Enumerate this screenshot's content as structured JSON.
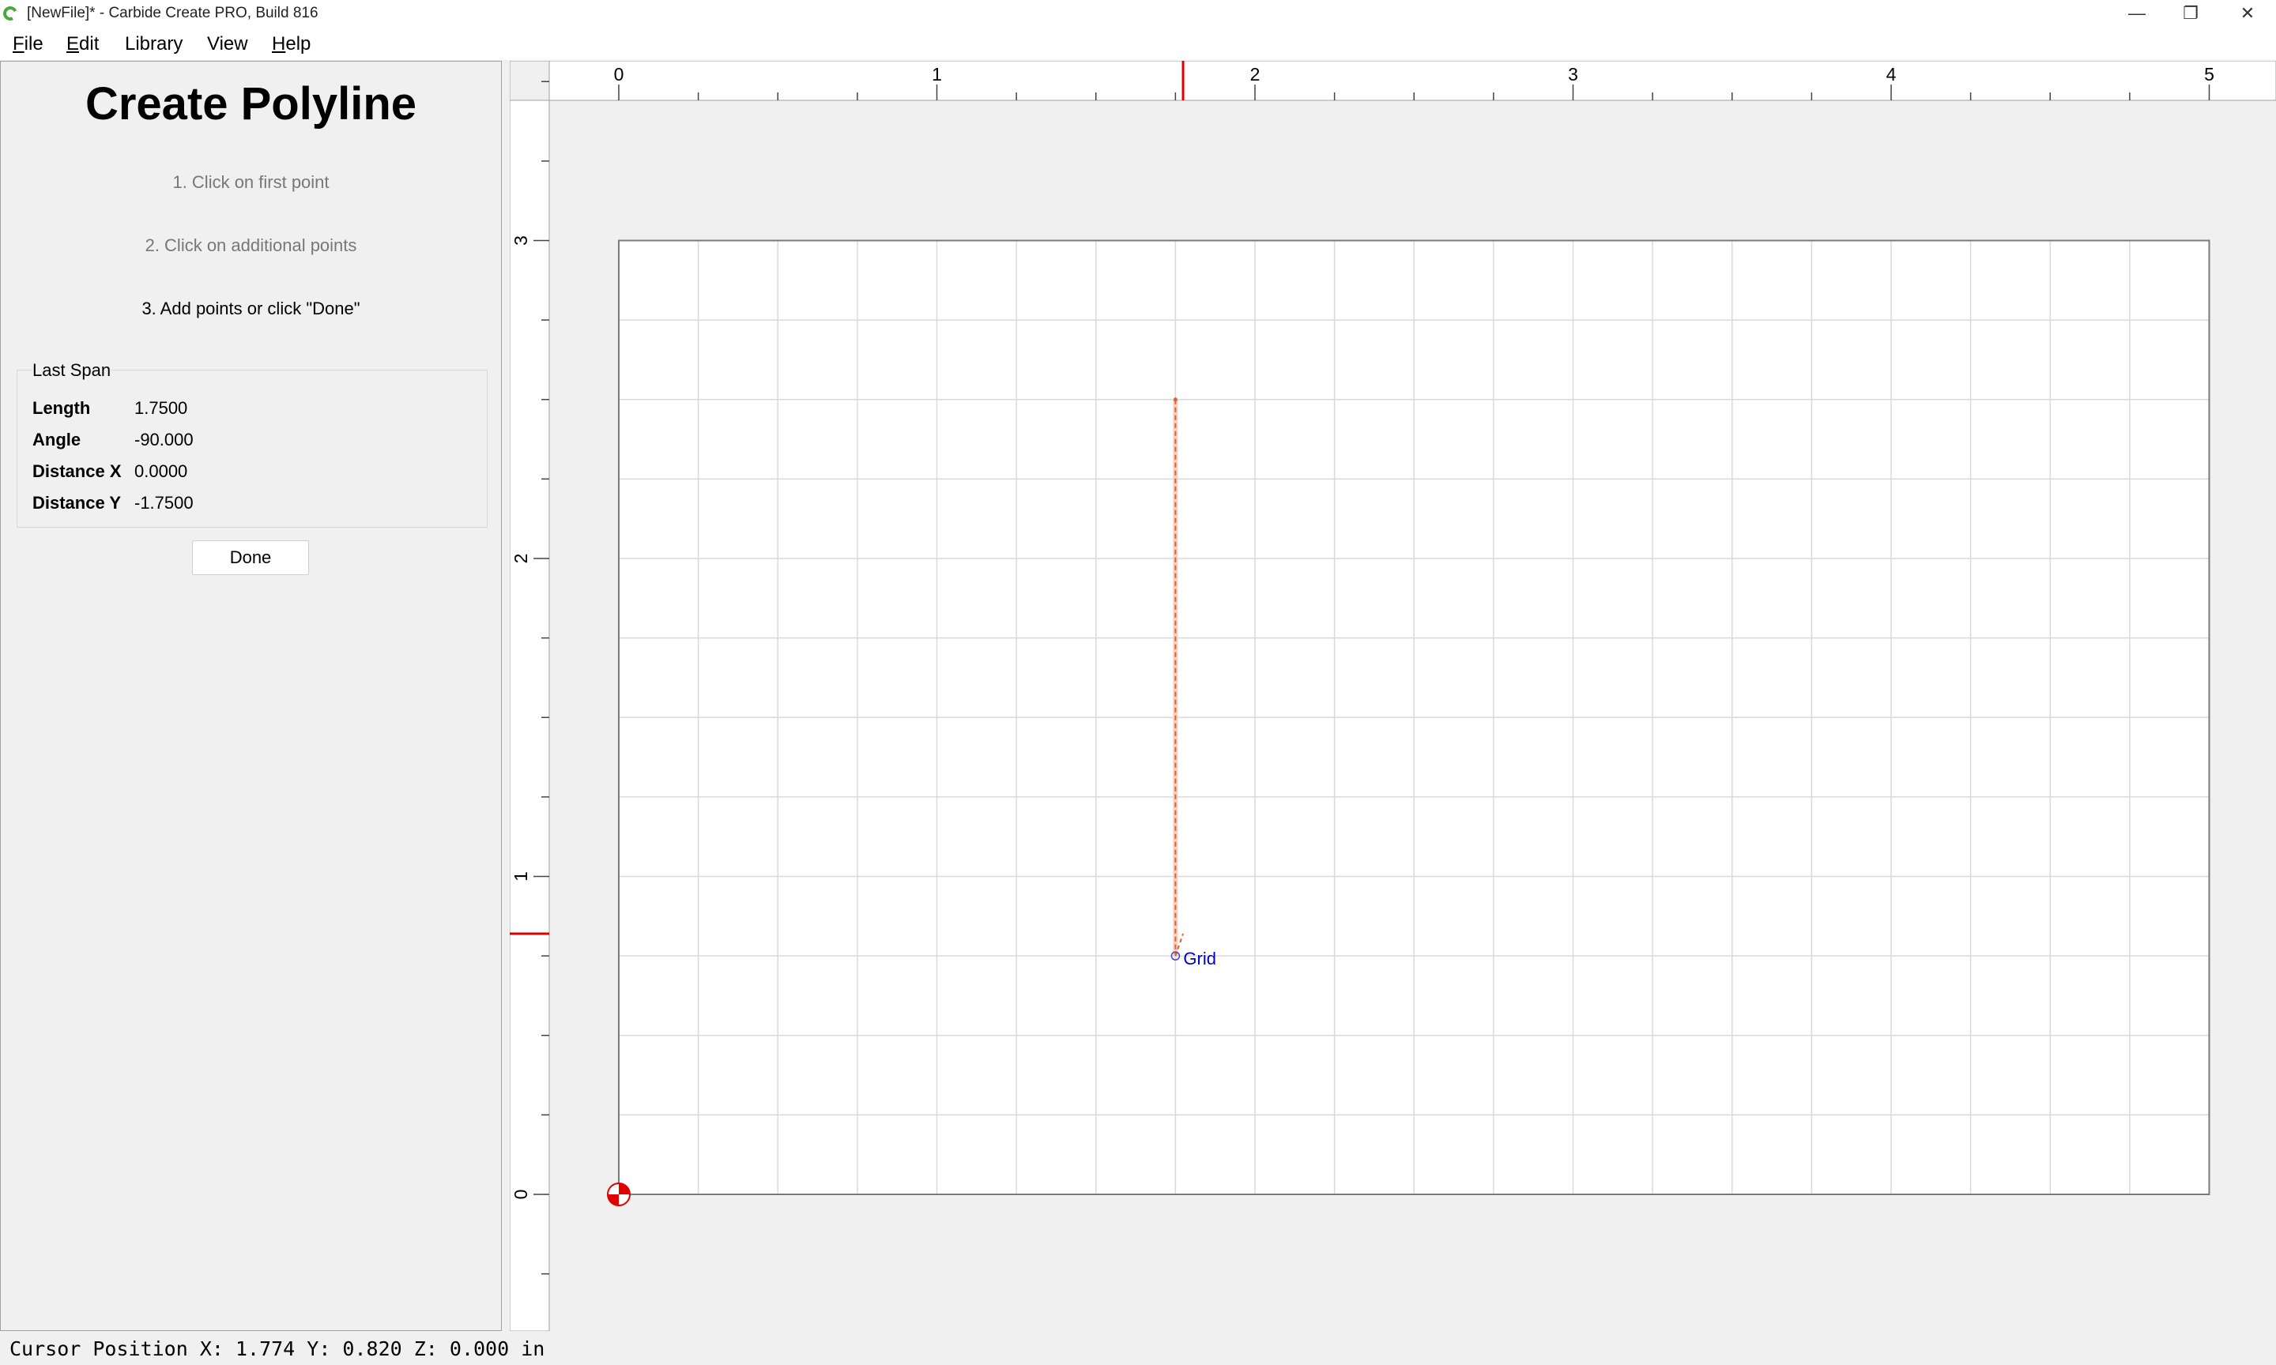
{
  "window": {
    "title": "[NewFile]* - Carbide Create PRO, Build 816",
    "minimize_icon": "minimize-icon",
    "maximize_icon": "restore-icon",
    "close_icon": "close-icon"
  },
  "menu": {
    "items": [
      {
        "label": "File",
        "mnemonic": "F",
        "rest": "ile"
      },
      {
        "label": "Edit",
        "mnemonic": "E",
        "rest": "dit"
      },
      {
        "label": "Library",
        "mnemonic": "",
        "rest": "Library"
      },
      {
        "label": "View",
        "mnemonic": "",
        "rest": "View"
      },
      {
        "label": "Help",
        "mnemonic": "H",
        "rest": "elp"
      }
    ]
  },
  "panel": {
    "title": "Create Polyline",
    "steps": [
      "1. Click on first point",
      "2. Click on additional points",
      "3. Add points or click \"Done\""
    ],
    "last_span": {
      "title": "Last Span",
      "rows": [
        {
          "label": "Length",
          "value": "1.7500"
        },
        {
          "label": "Angle",
          "value": "-90.000"
        },
        {
          "label": "Distance X",
          "value": "0.0000"
        },
        {
          "label": "Distance Y",
          "value": "-1.7500"
        }
      ]
    },
    "done_label": "Done"
  },
  "canvas": {
    "x_ruler_labels": [
      "0",
      "1",
      "2",
      "3",
      "4",
      "5"
    ],
    "y_ruler_labels": [
      "0",
      "1",
      "2",
      "3"
    ],
    "grid_extent": {
      "x": [
        0,
        5
      ],
      "y": [
        0,
        3
      ]
    },
    "grid_spacing": 0.25,
    "polyline": {
      "x": [
        1.75,
        1.75
      ],
      "y": [
        2.5,
        0.75
      ]
    },
    "rubber_band_end": {
      "x": 1.774,
      "y": 0.82
    },
    "cursor_x": 1.774,
    "cursor_y": 0.82,
    "snap_label": "Grid",
    "colors": {
      "grid": "#d9d9d9",
      "border": "#7a7a7a",
      "line": "#e06030",
      "cursor_marker": "#e00000",
      "snap_text": "#0000cc",
      "origin": "#e00000"
    }
  },
  "status": {
    "text": "Cursor Position X: 1.774 Y: 0.820 Z: 0.000 in"
  }
}
